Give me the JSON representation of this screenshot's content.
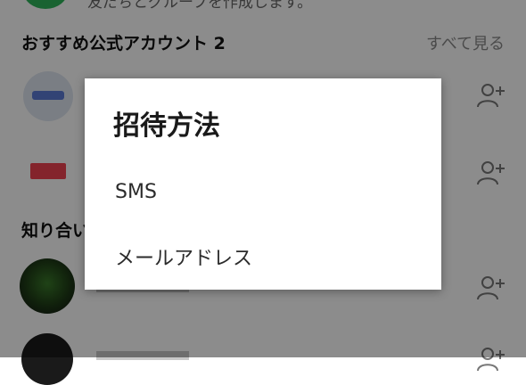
{
  "background": {
    "top_text": "友だちとグループを作成します。",
    "recommended_section": {
      "title": "おすすめ公式アカウント 2",
      "see_all": "すべて見る"
    },
    "acquaintance_section": {
      "title": "知り合い"
    }
  },
  "dialog": {
    "title": "招待方法",
    "options": [
      {
        "label": "SMS"
      },
      {
        "label": "メールアドレス"
      }
    ]
  },
  "colors": {
    "scrim": "#000000",
    "dialog_bg": "#ffffff",
    "line_green": "#2fb45a"
  }
}
